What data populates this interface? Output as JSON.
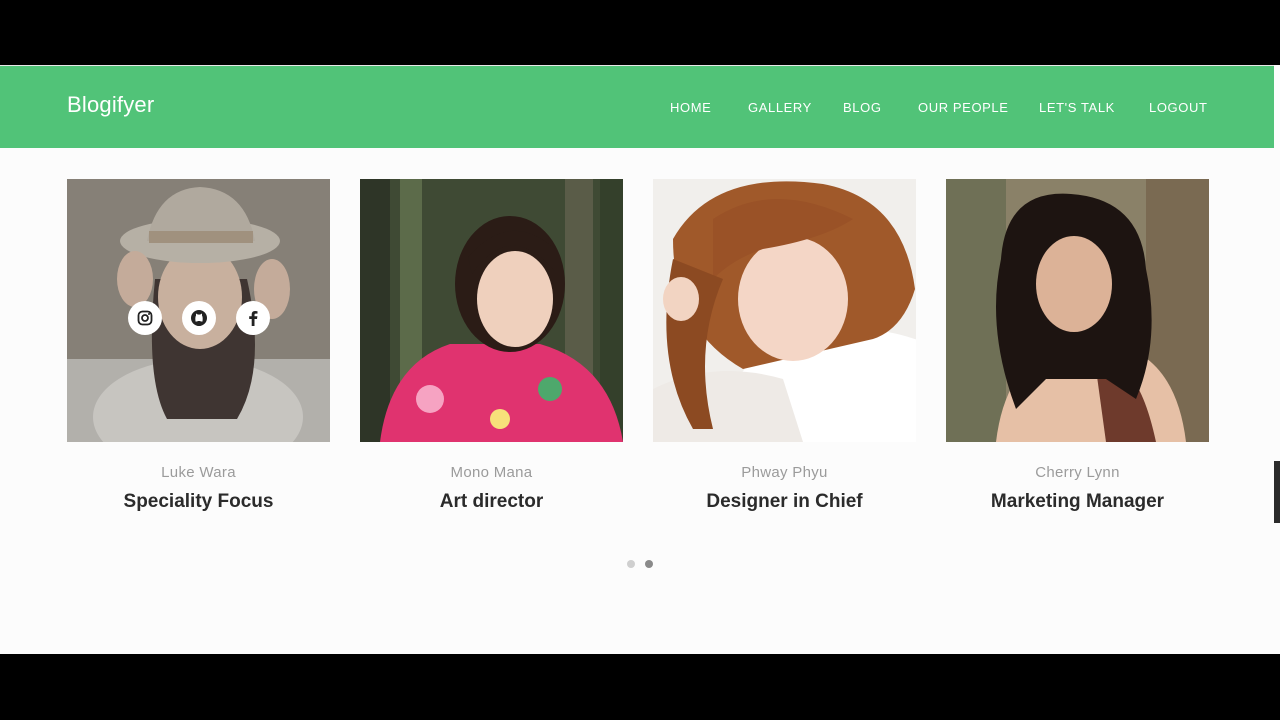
{
  "navbar": {
    "brand": "Blogifyer",
    "links": [
      "HOME",
      "GALLERY",
      "BLOG",
      "OUR PEOPLE",
      "LET'S TALK",
      "LOGOUT"
    ],
    "background_color": "#51c378"
  },
  "team": [
    {
      "name": "Luke Wara",
      "role": "Speciality Focus",
      "social_visible": true
    },
    {
      "name": "Mono Mana",
      "role": "Art director"
    },
    {
      "name": "Phway Phyu",
      "role": "Designer in Chief"
    },
    {
      "name": "Cherry Lynn",
      "role": "Marketing Manager"
    }
  ],
  "social_icons": [
    "instagram-icon",
    "github-icon",
    "facebook-icon"
  ],
  "carousel": {
    "page_count": 2,
    "active_index": 1
  }
}
